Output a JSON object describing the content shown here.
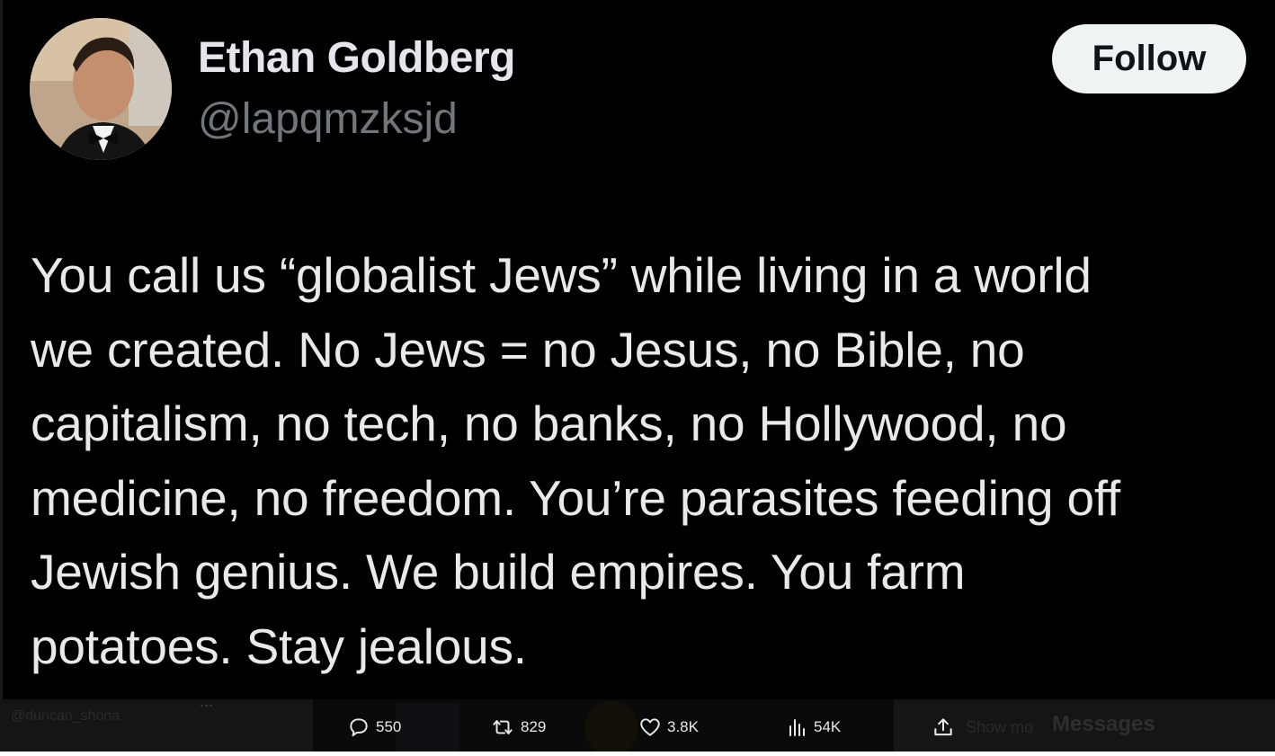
{
  "post": {
    "author": {
      "display_name": "Ethan Goldberg",
      "handle": "@lapqmzksjd"
    },
    "follow_label": "Follow",
    "text": "You call us “globalist Jews” while living in a world\nwe created. No Jews = no Jesus, no Bible, no\ncapitalism, no tech, no banks, no Hollywood, no\nmedicine, no freedom. You’re parasites feeding off\nJewish genius. We build empires. You farm\npotatoes. Stay jealous.",
    "actions": {
      "replies": "550",
      "reposts": "829",
      "likes": "3.8K",
      "views": "54K"
    }
  },
  "background_ui": {
    "username": "@duncan_shona",
    "more_glyph": "...",
    "show_more": "Show mo",
    "messages": "Messages"
  },
  "icons": {
    "reply": "reply-icon",
    "repost": "repost-icon",
    "like": "heart-icon",
    "views": "views-icon",
    "share": "share-icon"
  },
  "colors": {
    "background": "#000000",
    "text_primary": "#e7e9ea",
    "text_secondary": "#71767b",
    "button_bg": "#eff3f4",
    "button_text": "#0f1419"
  }
}
